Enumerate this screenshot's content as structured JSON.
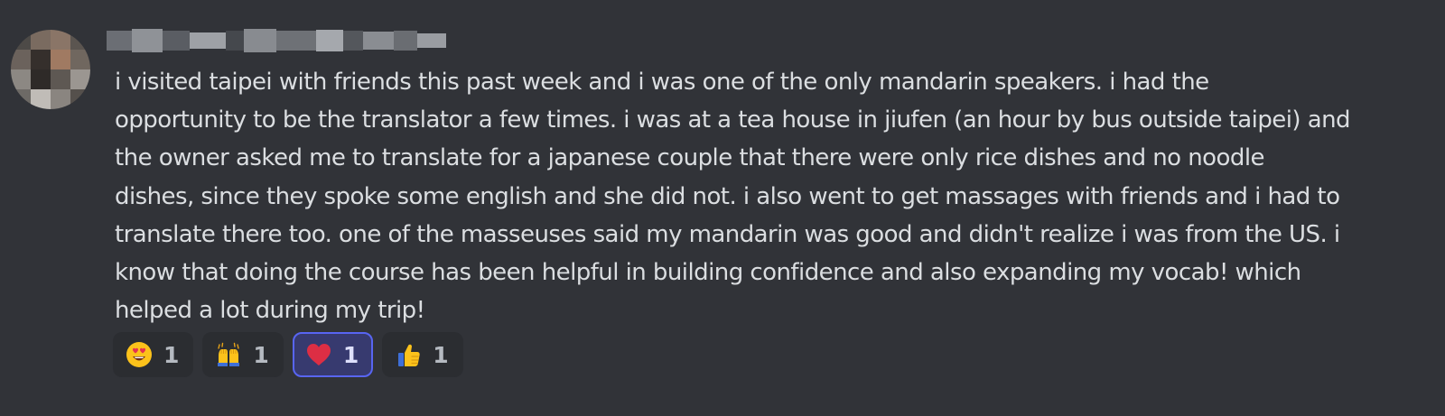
{
  "message": {
    "text": "i visited taipei with friends this past week and i was one of the only mandarin speakers. i had the\nopportunity to be the translator a few times. i was at a tea house in jiufen (an hour by bus outside taipei) and\nthe owner asked me to translate for a japanese couple that there were only rice dishes and no noodle\ndishes, since they spoke some english and she did not. i also went to get massages with friends and i had to\ntranslate there too. one of the masseuses said my mandarin was good and didn't realize i was from the US. i\nknow that doing the course has been helpful in building confidence and also expanding my vocab! which\nhelped a lot during my trip!"
  },
  "reactions": [
    {
      "icon": "heart-eyes-emoji-icon",
      "count": "1",
      "selected": false
    },
    {
      "icon": "raising-hands-emoji-icon",
      "count": "1",
      "selected": false
    },
    {
      "icon": "red-heart-emoji-icon",
      "count": "1",
      "selected": true
    },
    {
      "icon": "thumbs-up-emoji-icon",
      "count": "1",
      "selected": false
    }
  ],
  "colors": {
    "background": "#313338",
    "text": "#dbdee1",
    "reaction_bg": "#2b2d31",
    "reaction_selected_bg": "#373a6f",
    "reaction_selected_border": "#5865f2"
  }
}
